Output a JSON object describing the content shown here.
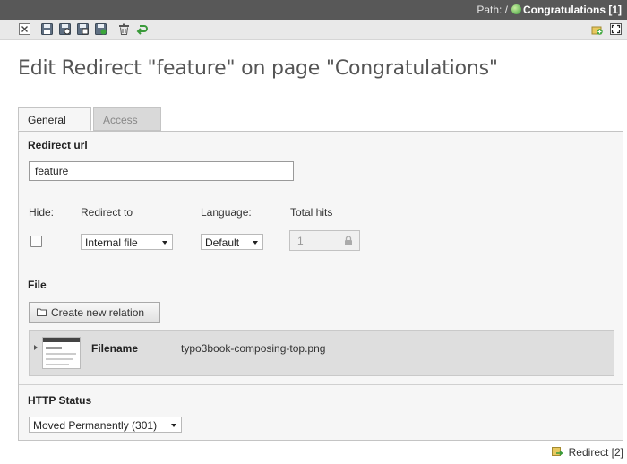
{
  "path": {
    "prefix": "Path: /",
    "page": "Congratulations [1]"
  },
  "toolbar": {
    "left_icons": [
      "close-icon",
      "save-icon",
      "save-view-icon",
      "save-new-icon",
      "save-close-icon",
      "delete-icon",
      "undo-icon"
    ],
    "right_icons": [
      "add-record-icon",
      "fullscreen-icon"
    ]
  },
  "title": "Edit Redirect \"feature\" on page \"Congratulations\"",
  "tabs": [
    {
      "label": "General"
    },
    {
      "label": "Access"
    }
  ],
  "form": {
    "redirect_url_label": "Redirect url",
    "redirect_url_value": "feature",
    "hide_label": "Hide:",
    "redirect_to_label": "Redirect to",
    "redirect_to_value": "Internal file",
    "language_label": "Language:",
    "language_value": "Default",
    "total_hits_label": "Total hits",
    "total_hits_value": "1",
    "file_section_label": "File",
    "create_relation_label": "Create new relation",
    "filename_label": "Filename",
    "filename_value": "typo3book-composing-top.png",
    "http_status_label": "HTTP Status",
    "http_status_value": "Moved Permanently (301)"
  },
  "footer": {
    "redirect_link": "Redirect [2]"
  },
  "colors": {
    "topbar": "#585858",
    "toolbar": "#e9e9e9",
    "panel": "#f6f6f6",
    "file_row": "#dedede"
  }
}
